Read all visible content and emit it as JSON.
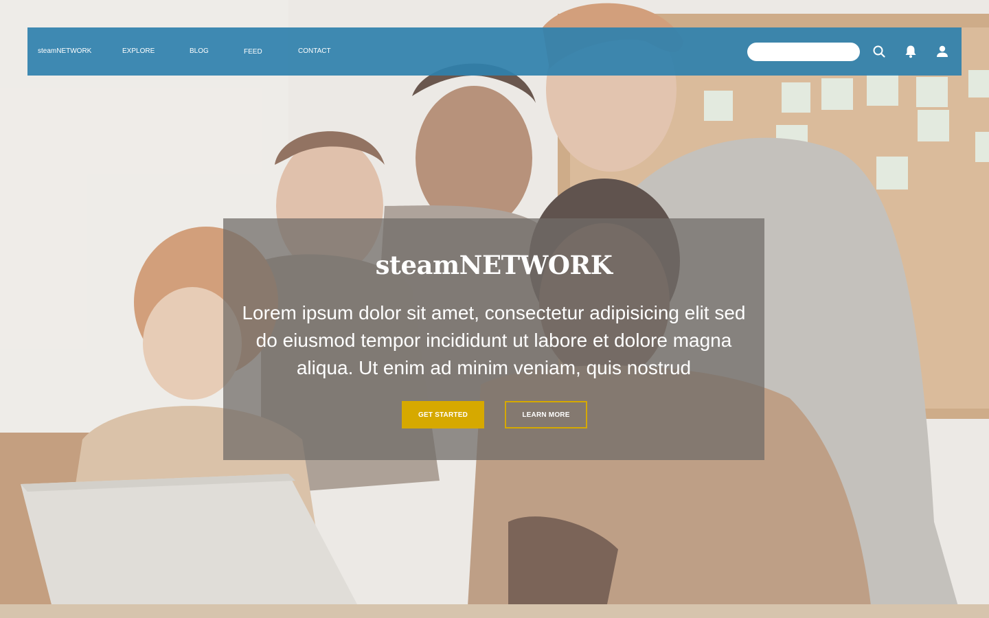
{
  "nav": {
    "brand": "steamNETWORK",
    "links": [
      "EXPLORE",
      "BLOG",
      "FEED",
      "CONTACT"
    ],
    "search_placeholder": "",
    "icons": [
      "search-icon",
      "bell-icon",
      "user-icon"
    ]
  },
  "hero": {
    "title": "steamNETWORK",
    "text": "Lorem ipsum dolor sit amet, consectetur adipisicing elit sed do eiusmod tempor incididunt ut labore et dolore magna aliqua. Ut enim ad minim veniam, quis nostrud",
    "primary_button": "GET STARTED",
    "secondary_button": "LEARN MORE"
  },
  "colors": {
    "navbar": "#2f80ad",
    "accent": "#d6a900",
    "card": "#706c68",
    "text": "#ffffff"
  }
}
